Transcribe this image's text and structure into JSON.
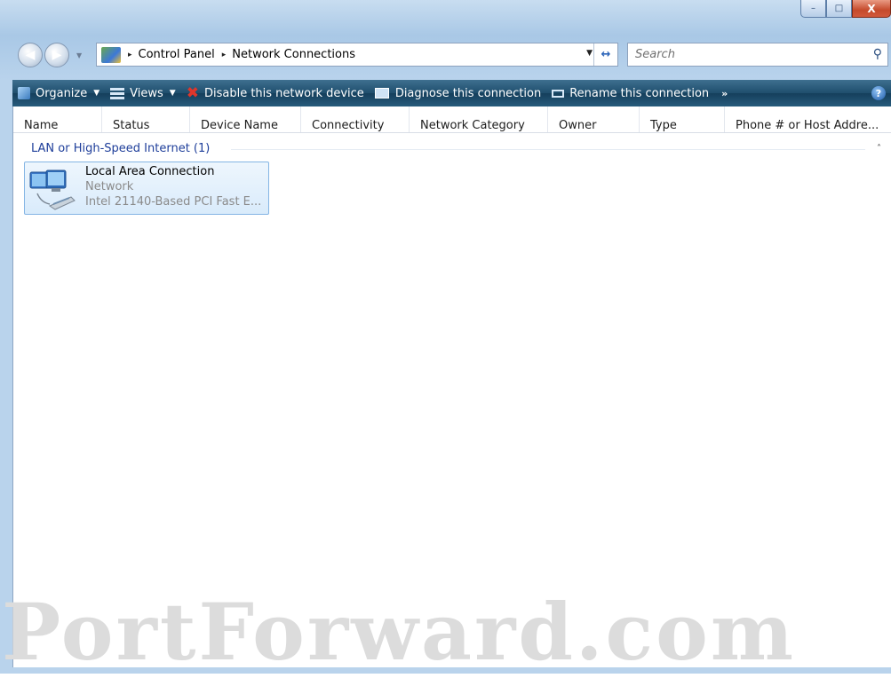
{
  "window": {
    "caption_min": "–",
    "caption_max": "□",
    "caption_close": "X"
  },
  "address_bar": {
    "separator": "▸",
    "crumbs": [
      "Control Panel",
      "Network Connections"
    ],
    "dropdown": "▼",
    "refresh": "↔"
  },
  "search": {
    "placeholder": "Search"
  },
  "toolbar": {
    "organize": "Organize",
    "views": "Views",
    "disable": "Disable this network device",
    "diagnose": "Diagnose this connection",
    "rename": "Rename this connection",
    "more": "»",
    "help": "?"
  },
  "columns": [
    "Name",
    "Status",
    "Device Name",
    "Connectivity",
    "Network Category",
    "Owner",
    "Type",
    "Phone # or Host Addre..."
  ],
  "group": {
    "label": "LAN or High-Speed Internet (1)",
    "toggle": "˄"
  },
  "connection": {
    "name": "Local Area Connection",
    "status": "Network",
    "device": "Intel 21140-Based PCI Fast E..."
  },
  "watermark": "PortForward.com",
  "colors": {
    "toolbar": "#1f4e6d",
    "group_text": "#1e3e9a",
    "tile_border": "#84b5e4"
  }
}
